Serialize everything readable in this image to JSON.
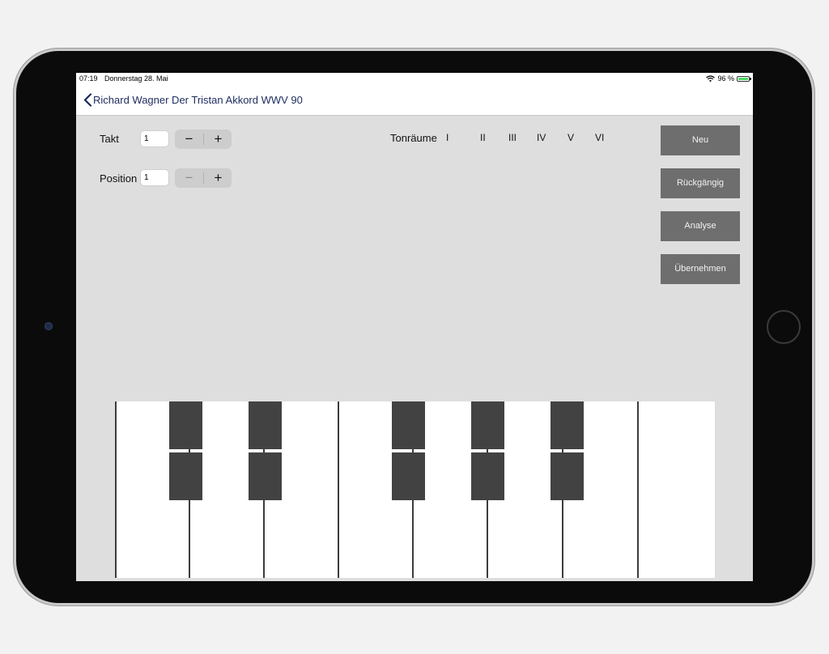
{
  "status_bar": {
    "time": "07:19",
    "date": "Donnerstag 28. Mai",
    "battery_percent": "96 %",
    "battery_level": 0.96,
    "wifi_icon": "wifi-icon",
    "battery_icon": "battery-charging-icon"
  },
  "nav": {
    "title": "Richard Wagner Der Tristan Akkord WWV 90",
    "back_icon": "chevron-left-icon"
  },
  "controls": {
    "takt_label": "Takt",
    "takt_value": "1",
    "position_label": "Position",
    "position_value": "1",
    "minus_symbol": "−",
    "plus_symbol": "+"
  },
  "tonraeume": {
    "label": "Tonräume",
    "options": [
      "I",
      "II",
      "III",
      "IV",
      "V",
      "VI"
    ]
  },
  "actions": {
    "neu": "Neu",
    "rueckgaengig": "Rückgängig",
    "analyse": "Analyse",
    "uebernehmen": "Übernehmen"
  },
  "colors": {
    "nav_text": "#1c2b5e",
    "button_bg": "#6e6e6e",
    "screen_bg": "#dedede",
    "black_key": "#424242"
  }
}
